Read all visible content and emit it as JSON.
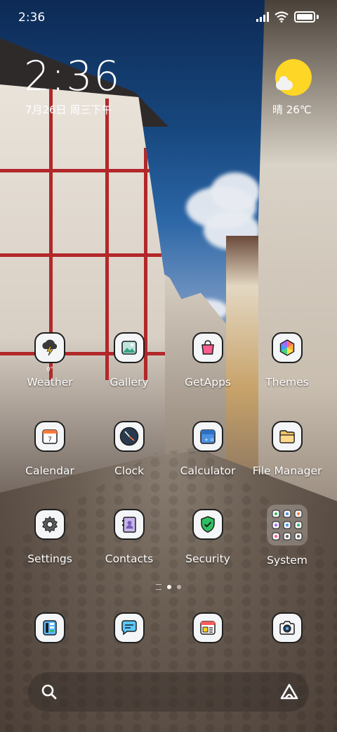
{
  "status_bar": {
    "time": "2:36"
  },
  "clock_widget": {
    "time": "2:36",
    "date": "7月26日 周三下午",
    "weather": "晴 26℃"
  },
  "apps": [
    {
      "label": "Weather",
      "icon": "weather-storm-icon",
      "sub": "0°"
    },
    {
      "label": "Gallery",
      "icon": "gallery-icon"
    },
    {
      "label": "GetApps",
      "icon": "shopping-bag-icon"
    },
    {
      "label": "Themes",
      "icon": "themes-hexagon-icon"
    },
    {
      "label": "Calendar",
      "icon": "calendar-icon",
      "sub": "7"
    },
    {
      "label": "Clock",
      "icon": "clock-icon"
    },
    {
      "label": "Calculator",
      "icon": "calculator-icon"
    },
    {
      "label": "File Manager",
      "icon": "folder-icon"
    },
    {
      "label": "Settings",
      "icon": "gear-icon"
    },
    {
      "label": "Contacts",
      "icon": "contacts-book-icon"
    },
    {
      "label": "Security",
      "icon": "shield-check-icon"
    },
    {
      "label": "System",
      "icon": "folder-grid-icon"
    }
  ],
  "dock": [
    {
      "icon": "phone-dialer-icon"
    },
    {
      "icon": "messages-icon"
    },
    {
      "icon": "browser-icon"
    },
    {
      "icon": "camera-icon"
    }
  ],
  "pager": {
    "pages": 2,
    "current": 1
  },
  "colors": {
    "weather_sun": "#fdd626",
    "security_shield": "#2fbf62",
    "getapps_bag": "#ff5d8f",
    "icon_outline": "#1f1f1f"
  }
}
